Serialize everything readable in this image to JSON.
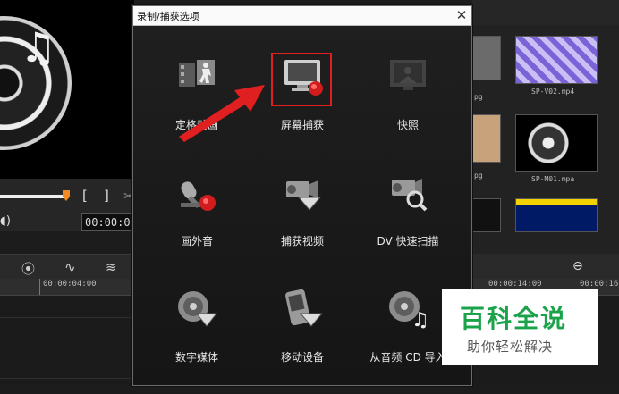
{
  "editor": {
    "mark_in": "[",
    "mark_out": "]",
    "timecode": "00:00:00",
    "ruler_left": "00:00:04:00",
    "ruler_right": "00:00:14:00",
    "ruler_right2": "00:00:16:00",
    "library": [
      {
        "caption": "SP-V02.mp4"
      },
      {
        "caption": "SP-M01.mpa"
      },
      {
        "caption": "pg"
      },
      {
        "caption": "pg"
      }
    ]
  },
  "dialog": {
    "title": "录制/捕获选项",
    "close_glyph": "✕",
    "options": [
      {
        "label": "定格动画",
        "icon": "stop-motion-icon",
        "state": "normal"
      },
      {
        "label": "屏幕捕获",
        "icon": "screen-capture-icon",
        "state": "highlighted"
      },
      {
        "label": "快照",
        "icon": "snapshot-icon",
        "state": "disabled"
      },
      {
        "label": "画外音",
        "icon": "voiceover-microphone-icon",
        "state": "normal"
      },
      {
        "label": "捕获视频",
        "icon": "capture-video-icon",
        "state": "normal"
      },
      {
        "label": "DV 快速扫描",
        "icon": "dv-quick-scan-icon",
        "state": "normal"
      },
      {
        "label": "数字媒体",
        "icon": "digital-media-icon",
        "state": "normal"
      },
      {
        "label": "移动设备",
        "icon": "mobile-device-icon",
        "state": "normal"
      },
      {
        "label": "从音频 CD 导入",
        "icon": "audio-cd-icon",
        "state": "normal"
      }
    ]
  },
  "watermark": {
    "main": "百科全说",
    "sub": "助你轻松解决"
  },
  "colors": {
    "highlight": "#e02020",
    "arrow": "#e02020",
    "record_dot": "#d01c1c",
    "watermark_green": "#1aa34a"
  }
}
